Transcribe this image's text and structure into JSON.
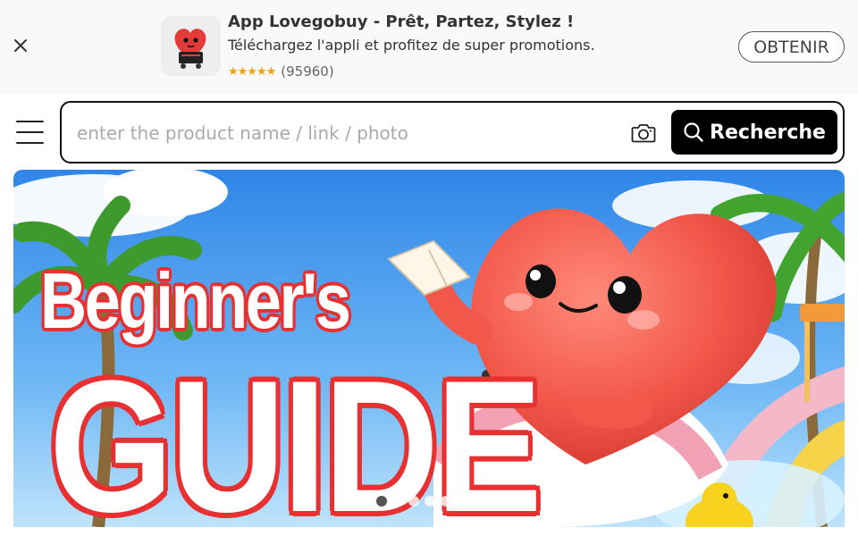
{
  "app_banner": {
    "title": "App Lovegobuy - Prêt, Partez, Stylez !",
    "subtitle": "Téléchargez l'appli et profitez de super promotions.",
    "rating_stars": "★★★★★",
    "rating_count": "(95960)",
    "get_label": "OBTENIR",
    "close_icon": "close-icon",
    "app_icon": "heart-mascot-cart-icon"
  },
  "search": {
    "placeholder": "enter the product name / link / photo",
    "value": "",
    "button_label": "Recherche",
    "camera_icon": "camera-icon",
    "search_icon": "search-icon"
  },
  "menu": {
    "icon": "hamburger-menu-icon"
  },
  "carousel": {
    "slide_text_line1": "Beginner's",
    "slide_text_line2": "GUIDE",
    "slide_count": 7,
    "active_index": 0
  },
  "colors": {
    "accent_red": "#e83030",
    "button_black": "#000000",
    "star_yellow": "#f2a10a"
  }
}
